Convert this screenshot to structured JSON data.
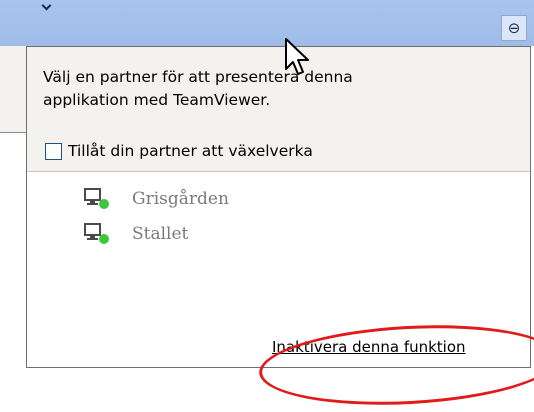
{
  "popup": {
    "message_line1": "Välj en partner för att presentera denna",
    "message_line2": "applikation med TeamViewer.",
    "allow_interact_label": "Tillåt din partner att växelverka",
    "allow_interact_checked": false,
    "partners": [
      {
        "name": "Grisgården",
        "status": "online",
        "icon": "monitor-online-icon"
      },
      {
        "name": "Stallet",
        "status": "online",
        "icon": "monitor-online-icon"
      }
    ],
    "disable_link": "Inaktivera denna funktion"
  },
  "titlebar": {
    "pin_icon": "pin-icon"
  },
  "colors": {
    "titlebar": "#a9c4ee",
    "popup_header": "#f4f2ee",
    "status_online": "#3fc63f",
    "highlight_ellipse": "#e11a1a"
  }
}
